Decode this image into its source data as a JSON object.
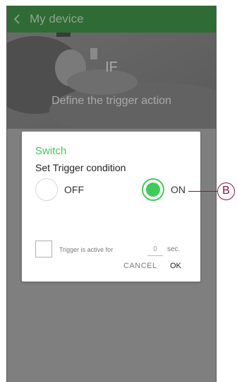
{
  "header": {
    "title": "My device"
  },
  "banner": {
    "if_label": "IF",
    "subtitle": "Define the trigger action"
  },
  "dialog": {
    "title": "Switch",
    "subtitle": "Set Trigger condition",
    "options": [
      {
        "label": "OFF",
        "selected": false
      },
      {
        "label": "ON",
        "selected": true
      }
    ],
    "trigger": {
      "label": "Trigger is active for",
      "value": "0",
      "unit": "sec.",
      "checked": false
    },
    "cancel_label": "CANCEL",
    "ok_label": "OK"
  },
  "callout": {
    "label": "B"
  },
  "colors": {
    "accent": "#3dcd58",
    "header": "#2f6b35",
    "callout": "#8a1538",
    "overlay": "#7f7f7f"
  }
}
